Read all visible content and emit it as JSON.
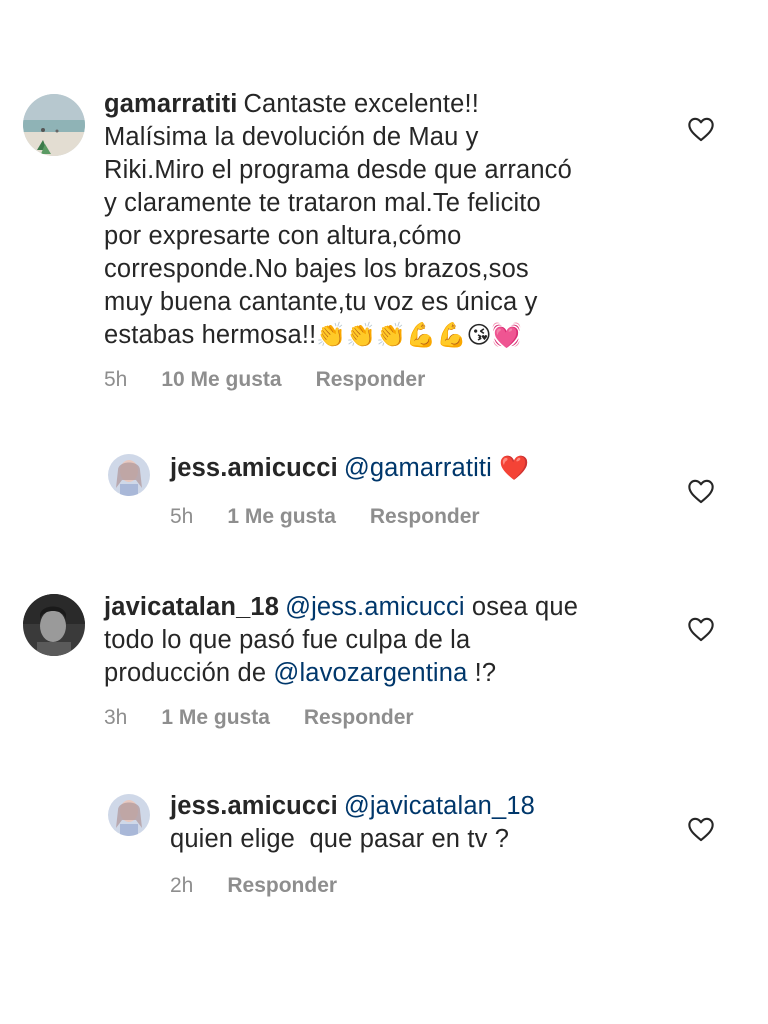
{
  "comments": [
    {
      "username": "gamarratiti",
      "text_lines": [
        "Cantaste excelente!!",
        "Malísima la devolución de Mau y",
        "Riki.Miro el programa desde que arrancó",
        "y claramente te trataron mal.Te felicito",
        "por expresarte con altura,cómo",
        "corresponde.No bajes los brazos,sos",
        "muy buena cantante,tu voz es única y",
        "estabas hermosa!!"
      ],
      "emojis": "👏👏👏💪💪😘💓",
      "time": "5h",
      "likes": "10 Me gusta",
      "reply": "Responder"
    },
    {
      "username": "jess.amicucci",
      "mention": "@gamarratiti",
      "emojis": "❤️",
      "time": "5h",
      "likes": "1 Me gusta",
      "reply": "Responder"
    },
    {
      "username": "javicatalan_18",
      "mention": "@jess.amicucci",
      "text_line1": "osea que",
      "text_line2": "todo lo que pasó fue culpa de la",
      "text_line3_pre": "producción de",
      "mention2": "@lavozargentina",
      "text_line3_post": "!?",
      "time": "3h",
      "likes": "1 Me gusta",
      "reply": "Responder"
    },
    {
      "username": "jess.amicucci",
      "mention": "@javicatalan_18",
      "text_line2": "quien elige  que pasar en tv ?",
      "time": "2h",
      "reply": "Responder"
    }
  ],
  "icons": {
    "like": "heart-outline-icon"
  },
  "colors": {
    "text": "#262626",
    "meta": "#8e8e8e",
    "mention": "#00376b"
  }
}
